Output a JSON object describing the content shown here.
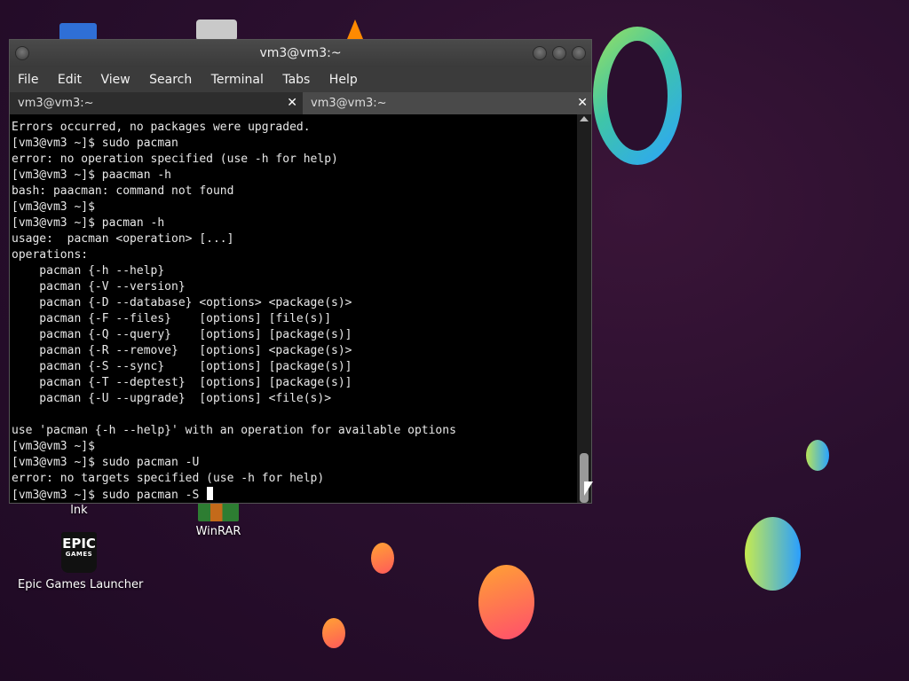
{
  "window": {
    "title": "vm3@vm3:~",
    "menu": [
      "File",
      "Edit",
      "View",
      "Search",
      "Terminal",
      "Tabs",
      "Help"
    ],
    "tabs": [
      {
        "label": "vm3@vm3:~",
        "close": "✕"
      },
      {
        "label": "vm3@vm3:~",
        "close": "✕"
      }
    ]
  },
  "terminal": {
    "lines": [
      "Errors occurred, no packages were upgraded.",
      "[vm3@vm3 ~]$ sudo pacman",
      "error: no operation specified (use -h for help)",
      "[vm3@vm3 ~]$ paacman -h",
      "bash: paacman: command not found",
      "[vm3@vm3 ~]$",
      "[vm3@vm3 ~]$ pacman -h",
      "usage:  pacman <operation> [...]",
      "operations:",
      "    pacman {-h --help}",
      "    pacman {-V --version}",
      "    pacman {-D --database} <options> <package(s)>",
      "    pacman {-F --files}    [options] [file(s)]",
      "    pacman {-Q --query}    [options] [package(s)]",
      "    pacman {-R --remove}   [options] <package(s)>",
      "    pacman {-S --sync}     [options] [package(s)]",
      "    pacman {-T --deptest}  [options] [package(s)]",
      "    pacman {-U --upgrade}  [options] <file(s)>",
      "",
      "use 'pacman {-h --help}' with an operation for available options",
      "[vm3@vm3 ~]$",
      "[vm3@vm3 ~]$ sudo pacman -U",
      "error: no targets specified (use -h for help)"
    ],
    "current_input": "[vm3@vm3 ~]$ sudo pacman -S "
  },
  "desktop": {
    "icons": [
      {
        "label": "lnk"
      },
      {
        "label": "WinRAR"
      },
      {
        "label": "Epic Games Launcher",
        "logo_text": "EPIC",
        "logo_sub": "GAMES"
      }
    ]
  }
}
